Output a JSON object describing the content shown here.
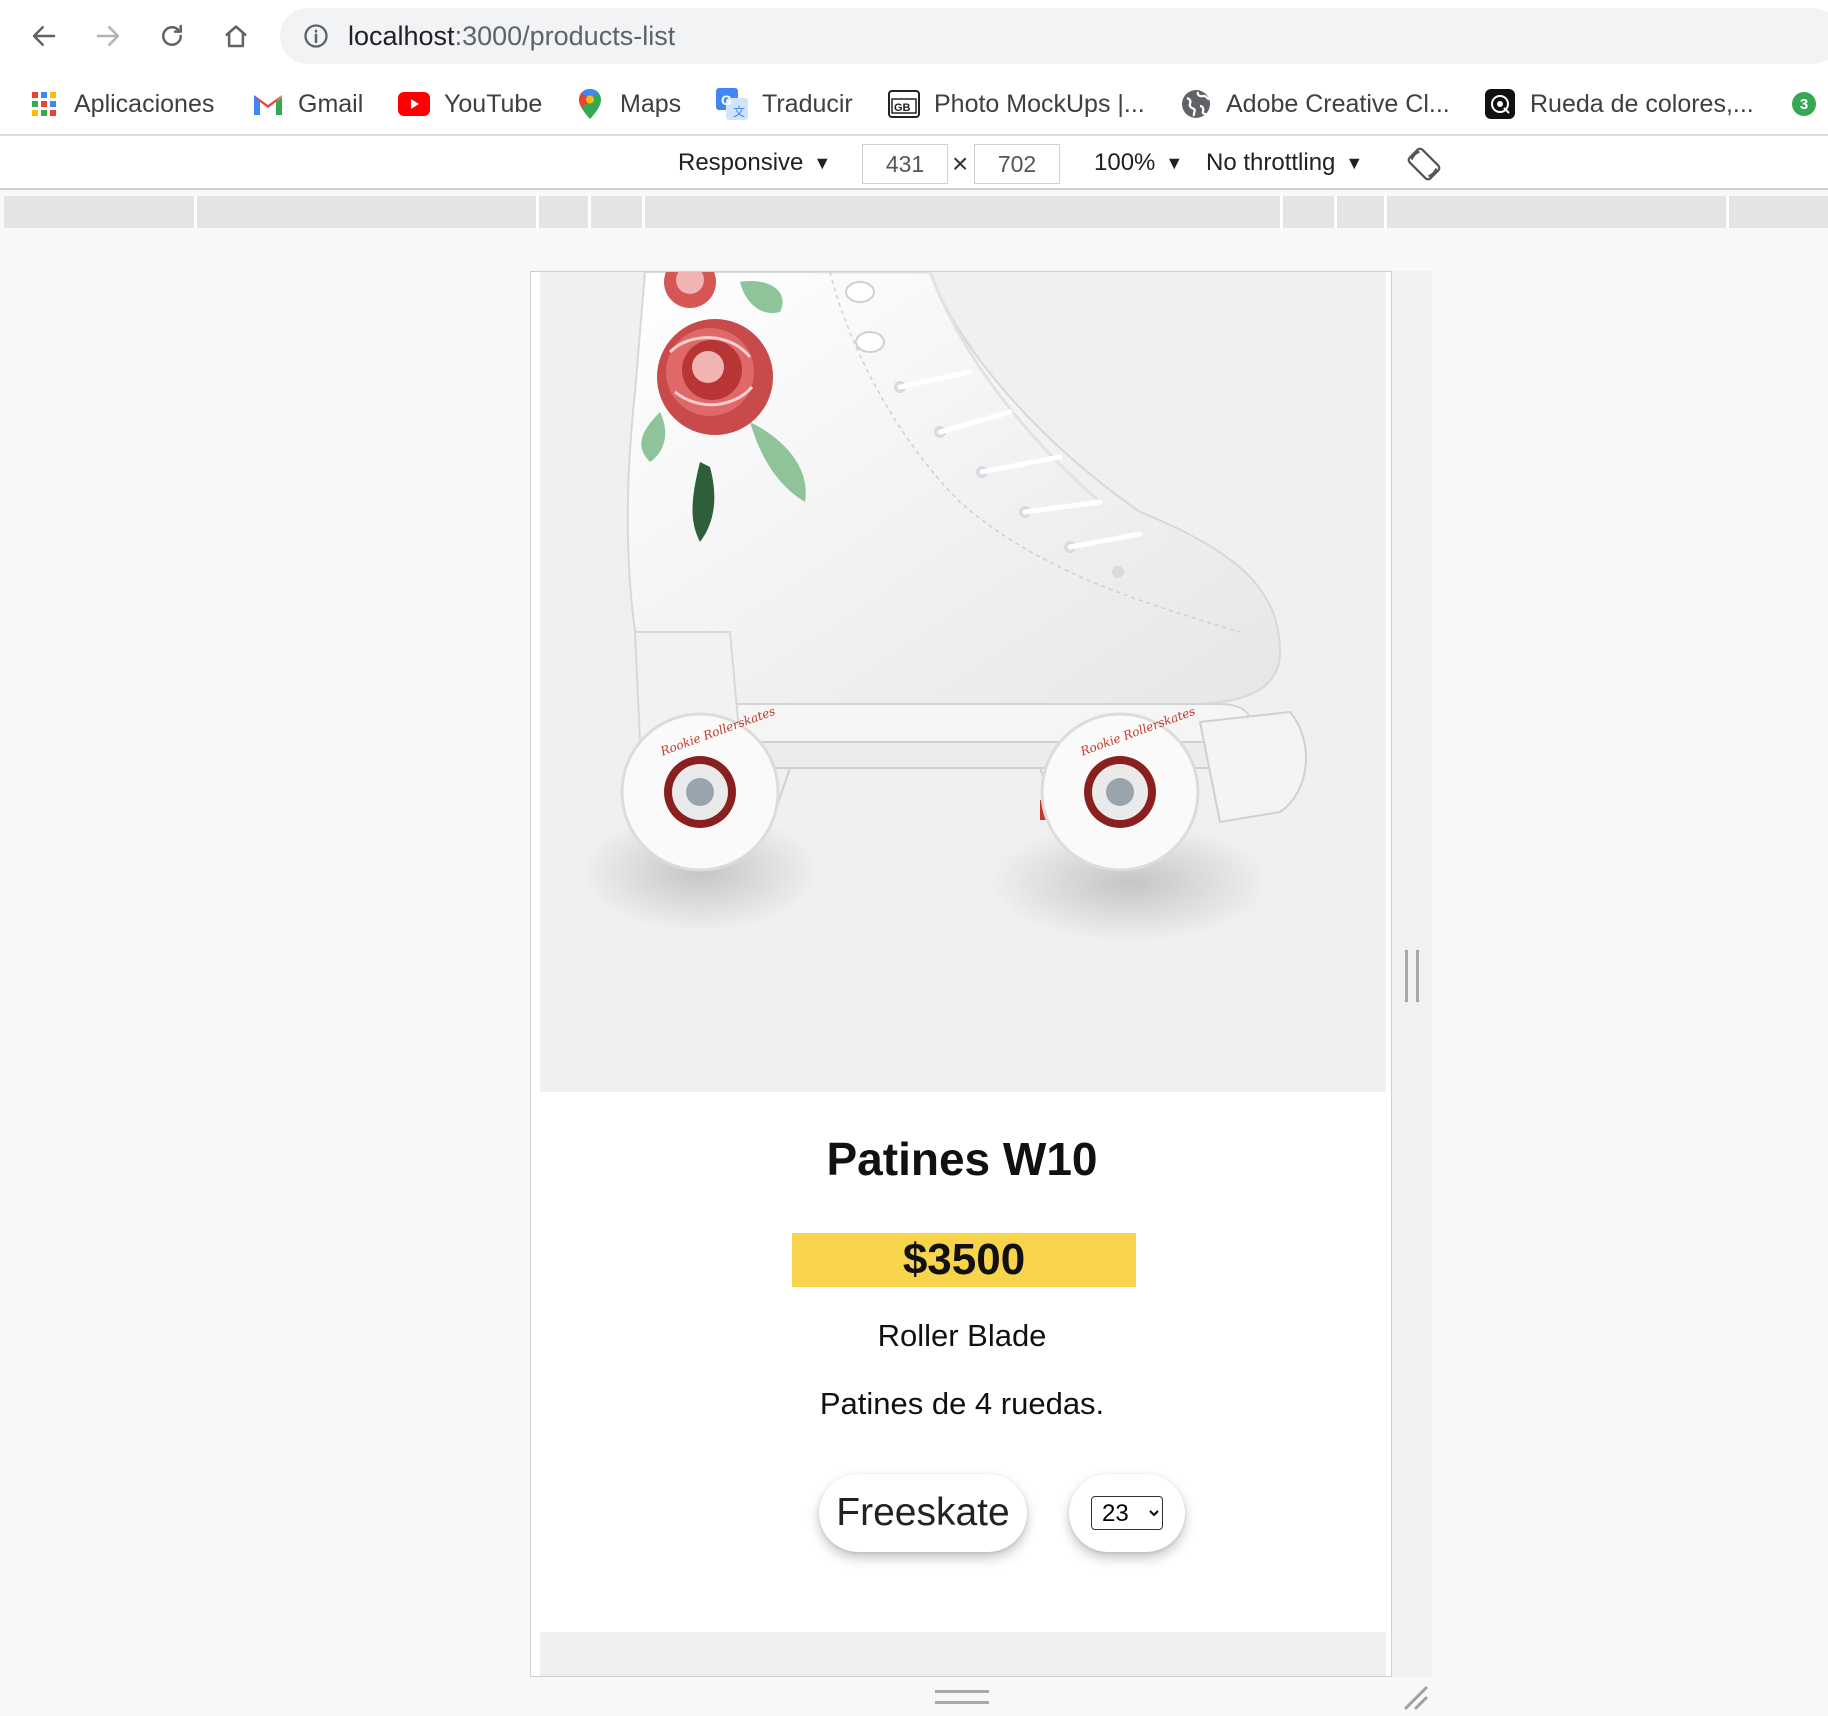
{
  "browser": {
    "url_host": "localhost",
    "url_path": ":3000/products-list"
  },
  "bookmarks": [
    {
      "label": "Aplicaciones",
      "icon": "apps-grid-icon"
    },
    {
      "label": "Gmail",
      "icon": "gmail-icon"
    },
    {
      "label": "YouTube",
      "icon": "youtube-icon"
    },
    {
      "label": "Maps",
      "icon": "maps-pin-icon"
    },
    {
      "label": "Traducir",
      "icon": "translate-icon"
    },
    {
      "label": "Photo MockUps |...",
      "icon": "mockups-icon"
    },
    {
      "label": "Adobe Creative Cl...",
      "icon": "globe-icon"
    },
    {
      "label": "Rueda de colores,...",
      "icon": "color-wheel-icon"
    }
  ],
  "extension_badge": "3",
  "devtools": {
    "device": "Responsive",
    "width": "431",
    "height": "702",
    "times": "×",
    "zoom": "100%",
    "throttling": "No throttling"
  },
  "product": {
    "title": "Patines W10",
    "price": "$3500",
    "brand": "Roller Blade",
    "description": "Patines de 4 ruedas.",
    "category": "Freeskate",
    "size_selected": "23",
    "image_icon": "roller-skate-image"
  },
  "colors": {
    "price_highlight": "#f7d44c",
    "url_path": "#5f6368"
  }
}
